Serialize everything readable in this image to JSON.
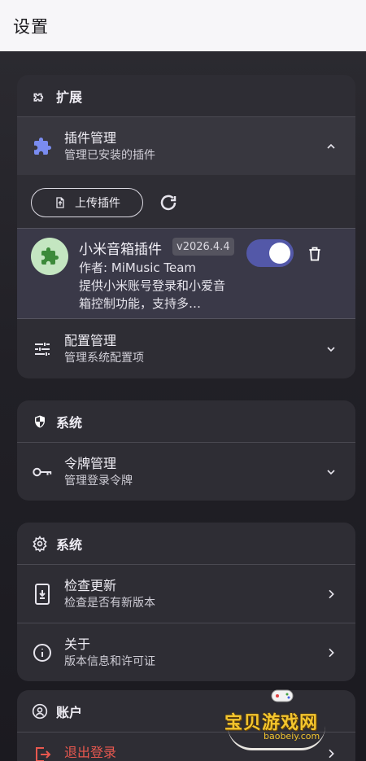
{
  "header": {
    "title": "设置"
  },
  "extensions": {
    "title": "扩展",
    "plugin_mgmt": {
      "title": "插件管理",
      "subtitle": "管理已安装的插件"
    },
    "upload_label": "上传插件",
    "plugin": {
      "name": "小米音箱插件",
      "version": "v2026.4.4",
      "author": "作者: MiMusic Team",
      "description": "提供小米账号登录和小爱音箱控制功能，支持多…",
      "enabled": true
    },
    "config_mgmt": {
      "title": "配置管理",
      "subtitle": "管理系统配置项"
    }
  },
  "system1": {
    "title": "系统",
    "token_mgmt": {
      "title": "令牌管理",
      "subtitle": "管理登录令牌"
    }
  },
  "system2": {
    "title": "系统",
    "check_update": {
      "title": "检查更新",
      "subtitle": "检查是否有新版本"
    },
    "about": {
      "title": "关于",
      "subtitle": "版本信息和许可证"
    }
  },
  "account": {
    "title": "账户",
    "logout": {
      "title": "退出登录"
    }
  },
  "watermark": {
    "text": "宝贝游戏网",
    "url": "baobeiy.com"
  },
  "colors": {
    "accent": "#5358a8",
    "danger": "#e8584f",
    "plugin_icon": "#7a8cf0"
  }
}
